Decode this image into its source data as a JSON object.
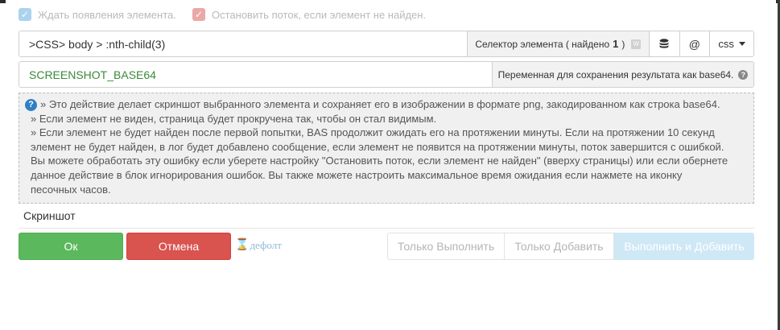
{
  "options": {
    "wait_label": "Ждать появления элемента.",
    "stop_label": "Остановить поток, если элемент не найден."
  },
  "selector": {
    "value": ">CSS> body > :nth-child(3)",
    "label_prefix": "Селектор элемента ( найдено",
    "found_count": "1",
    "label_suffix": ")",
    "w_icon": "W",
    "db_icon": "database-icon",
    "at_label": "@",
    "type_label": "css"
  },
  "variable": {
    "value": "SCREENSHOT_BASE64",
    "label": "Переменная для сохранения результата как base64.",
    "help_glyph": "?"
  },
  "help": {
    "icon_glyph": "?",
    "lines": [
      "» Это действие делает скриншот выбранного элемента и сохраняет его в изображении в формате png, закодированном как строка base64.",
      "» Если элемент не виден, страница будет прокручена так, чтобы он стал видимым.",
      "» Если элемент не будет найден после первой попытки, BAS продолжит ожидать его на протяжении минуты. Если на протяжении 10 секунд",
      "элемент не будет найден, в лог будет добавлено сообщение, если элемент не появится на протяжении минуты, поток завершится с ошибкой.",
      "Вы можете обработать эту ошибку если уберете настройку \"Остановить поток, если элемент не найден\" (вверху страницы) или если обернете",
      "данное действие в блок игнорирования ошибок. Вы также можете настроить максимальное время ожидания если нажмете на иконку",
      "песочных часов."
    ]
  },
  "action_name": "Скриншот",
  "buttons": {
    "ok": "Ок",
    "cancel": "Отмена",
    "default": "дефолт",
    "run_only": "Только Выполнить",
    "add_only": "Только Добавить",
    "run_and_add": "Выполнить и Добавить"
  },
  "colors": {
    "ok": "#5cb85c",
    "cancel": "#d9534f",
    "info": "#2e7fc4",
    "var_text": "#3a8a3a"
  }
}
